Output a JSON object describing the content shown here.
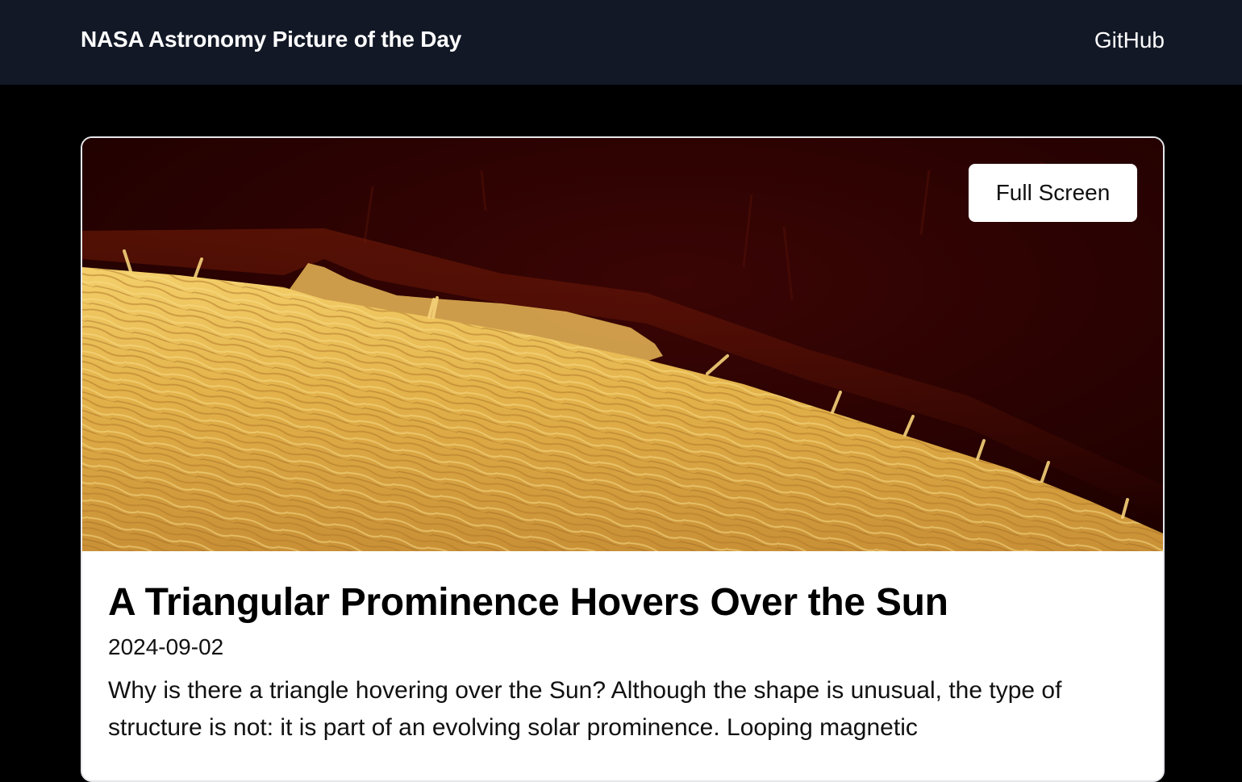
{
  "header": {
    "title": "NASA Astronomy Picture of the Day",
    "github_label": "GitHub"
  },
  "apod": {
    "title": "A Triangular Prominence Hovers Over the Sun",
    "date": "2024-09-02",
    "explanation": "Why is there a triangle hovering over the Sun? Although the shape is unusual, the type of structure is not: it is part of an evolving solar prominence. Looping magnetic",
    "fullscreen_label": "Full Screen"
  },
  "colors": {
    "header_bg": "#121826",
    "page_bg": "#000000",
    "card_bg": "#ffffff",
    "sun_surface": "#e8b84a",
    "sky": "#2a0000"
  }
}
